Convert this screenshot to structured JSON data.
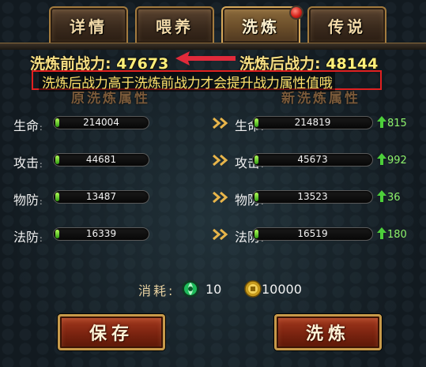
{
  "tabs": [
    {
      "label": "详情"
    },
    {
      "label": "喂养"
    },
    {
      "label": "洗炼"
    },
    {
      "label": "传说"
    }
  ],
  "power": {
    "before_label": "洗炼前战力:",
    "before_value": "47673",
    "after_label": "洗炼后战力:",
    "after_value": "48144"
  },
  "notice": "洗炼后战力高于洗炼前战力才会提升战力属性值哦",
  "columns": {
    "original": "原洗炼属性",
    "new": "新洗炼属性"
  },
  "stats": [
    {
      "name": "生命",
      "old": "214004",
      "new": "214819",
      "gain": "815"
    },
    {
      "name": "攻击",
      "old": "44681",
      "new": "45673",
      "gain": "992"
    },
    {
      "name": "物防",
      "old": "13487",
      "new": "13523",
      "gain": "36"
    },
    {
      "name": "法防",
      "old": "16339",
      "new": "16519",
      "gain": "180"
    }
  ],
  "cost": {
    "label": "消耗:",
    "gem_amount": "10",
    "gold_amount": "10000"
  },
  "buttons": {
    "save": "保存",
    "refine": "洗炼"
  },
  "icons": {
    "gem": "green-gem-icon",
    "coin": "gold-coin-icon",
    "arrow": "double-chevron-right-icon",
    "up": "up-arrow-icon"
  },
  "colors": {
    "power_text": "#f6df84",
    "gain_green": "#8df26b",
    "notice_border": "#e02020",
    "button_red": "#7b2410"
  }
}
